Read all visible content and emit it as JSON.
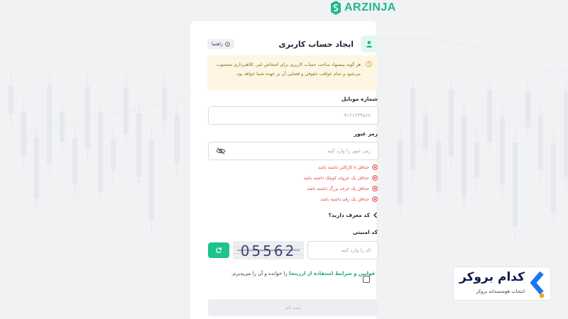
{
  "brand": {
    "name": "ARZINJA",
    "accent": "#1fb98a"
  },
  "form": {
    "title": "ایجاد حساب کاربری",
    "guide_label": "راهنما",
    "warning": "هر گونه پیشنهاد ساخت حساب کاربری برای اشخاص غیر، کلاهبرداری محسوب می‌شود و تمام عواقب حقوقی و قضایی آن بر عهده شما خواهد بود.",
    "mobile": {
      "label": "شماره موبایل",
      "placeholder": "۰۹۱۲۱۲۳۴۵۶۷"
    },
    "password": {
      "label": "رمز عبور",
      "placeholder": "رمز عبور را وارد کنید",
      "rules": [
        "حداقل ۸ کاراکتر داشته باشد",
        "حداقل یک حروف کوچک داشته باشد",
        "حداقل یک حرف بزرگ داشته باشد",
        "حداقل یک رقم داشته باشد"
      ]
    },
    "referral_label": "کد معرف دارید؟",
    "captcha": {
      "label": "کد امنیتی",
      "placeholder": "کد را وارد کنید",
      "image_text": "05562"
    },
    "terms": {
      "link": "قوانین و شرایط استفاده از ارزینجا",
      "text": " را خوانده و آن را می‌پذیرم."
    },
    "submit_label": "ثبت نام"
  },
  "badge": {
    "name": "کدام بروکر",
    "tagline": "انتخاب هوشمندانه بروکر"
  },
  "icons": [
    "logo-icon",
    "user-icon",
    "info-icon",
    "warning-icon",
    "eye-off-icon",
    "error-circle-icon",
    "chevron-left-icon",
    "refresh-icon",
    "checkbox-icon"
  ]
}
